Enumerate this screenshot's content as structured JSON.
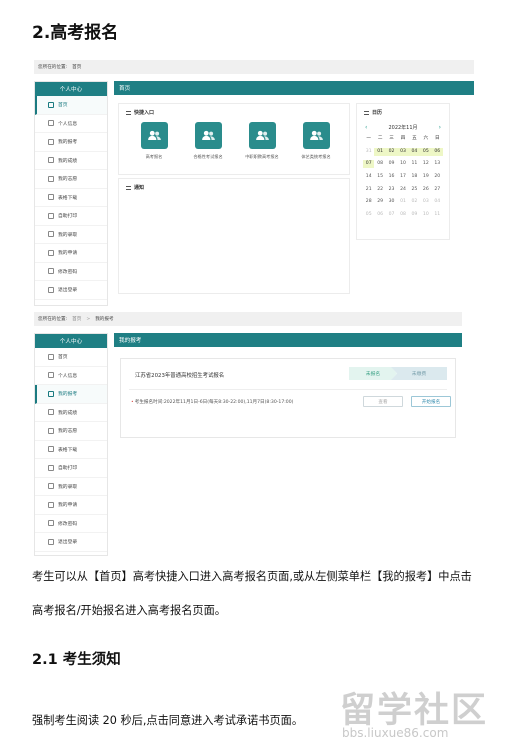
{
  "heading_main": "2.高考报名",
  "screenshot1": {
    "breadcrumb": {
      "prefix": "您所在的位置:",
      "current": "首页"
    },
    "sidebar": {
      "header": "个人中心",
      "items": [
        "首页",
        "个人信息",
        "我的报考",
        "我的成绩",
        "我的志愿",
        "表格下载",
        "自助打印",
        "我的录取",
        "我的申请",
        "修改密码",
        "退出登录"
      ]
    },
    "main_header": "首页",
    "quick_entry": {
      "title": "快捷入口",
      "items": [
        "高考报名",
        "合格性考试报名",
        "中职职教高考报名",
        "体艺类统考报名"
      ]
    },
    "notice": {
      "title": "通知"
    },
    "calendar": {
      "title": "日历",
      "month": "2022年11月",
      "prev": "‹",
      "next": "›",
      "weekdays": [
        "一",
        "二",
        "三",
        "四",
        "五",
        "六",
        "日"
      ],
      "days": [
        "31",
        "01",
        "02",
        "03",
        "04",
        "05",
        "06",
        "07",
        "08",
        "09",
        "10",
        "11",
        "12",
        "13",
        "14",
        "15",
        "16",
        "17",
        "18",
        "19",
        "20",
        "21",
        "22",
        "23",
        "24",
        "25",
        "26",
        "27",
        "28",
        "29",
        "30",
        "01",
        "02",
        "03",
        "04",
        "05",
        "06",
        "07",
        "08",
        "09",
        "10",
        "11"
      ]
    }
  },
  "screenshot2": {
    "breadcrumb": {
      "prefix": "您所在的位置:",
      "home": "首页",
      "sep": ">",
      "current": "我的报考"
    },
    "sidebar": {
      "header": "个人中心",
      "items": [
        "首页",
        "个人信息",
        "我的报考",
        "我的成绩",
        "我的志愿",
        "表格下载",
        "自助打印",
        "我的录取",
        "我的申请",
        "修改密码",
        "退出登录"
      ]
    },
    "main_header": "我的报考",
    "enroll": {
      "title": "江苏省2023年普通高校招生考试报名",
      "step_done": "未报名",
      "step_next": "未缴费",
      "time": "考生报名时间:2022年11月1日-6日(每天8:30-22:00),11月7日(8:30-17:00)",
      "btn_view": "查看",
      "btn_start": "开始报名"
    }
  },
  "paragraph1_line1": "考生可以从【首页】高考快捷入口进入高考报名页面,或从左侧菜单栏【我的报考】中点击",
  "paragraph1_line2": "高考报名/开始报名进入高考报名页面。",
  "heading_sub": "2.1 考生须知",
  "paragraph2": "强制考生阅读 20 秒后,点击同意进入考试承诺书页面。",
  "watermark": {
    "main": "留学社区",
    "url": "bbs.liuxue86.com"
  },
  "colors": {
    "teal": "#1f7f84",
    "calendar_highlight": "#eef7c6"
  }
}
